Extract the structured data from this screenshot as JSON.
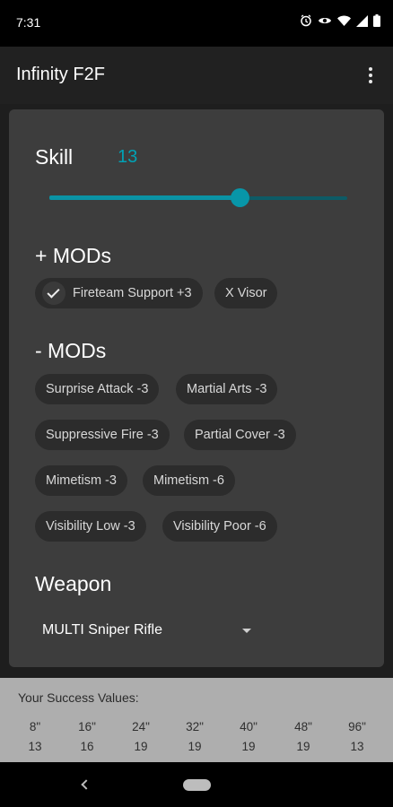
{
  "status_bar": {
    "time": "7:31",
    "icons": [
      "alarm-icon",
      "eye-icon",
      "wifi-icon",
      "signal-icon",
      "battery-icon"
    ]
  },
  "app_bar": {
    "title": "Infinity F2F",
    "overflow_icon": "more-vert-icon"
  },
  "skill": {
    "label": "Skill",
    "value": "13",
    "slider_fraction": 0.64,
    "accent": "#00a2b5"
  },
  "plus_mods": {
    "title": "+ MODs",
    "chips": [
      {
        "label": "Fireteam Support +3",
        "selected": true
      },
      {
        "label": "X Visor",
        "selected": false
      }
    ]
  },
  "minus_mods": {
    "title": "- MODs",
    "chips": [
      {
        "label": "Surprise Attack -3"
      },
      {
        "label": "Martial Arts -3"
      },
      {
        "label": "Suppressive Fire -3"
      },
      {
        "label": "Partial Cover -3"
      },
      {
        "label": "Mimetism -3"
      },
      {
        "label": "Mimetism -6"
      },
      {
        "label": "Visibility Low -3"
      },
      {
        "label": "Visibility Poor -6"
      }
    ]
  },
  "weapon": {
    "title": "Weapon",
    "selected": "MULTI Sniper Rifle"
  },
  "results": {
    "title": "Your Success Values:",
    "columns": [
      {
        "range": "8\"",
        "value": "13"
      },
      {
        "range": "16\"",
        "value": "16"
      },
      {
        "range": "24\"",
        "value": "19"
      },
      {
        "range": "32\"",
        "value": "19"
      },
      {
        "range": "40\"",
        "value": "19"
      },
      {
        "range": "48\"",
        "value": "19"
      },
      {
        "range": "96\"",
        "value": "13"
      }
    ]
  },
  "nav_bar": {
    "back_icon": "back-icon",
    "home_icon": "home-pill-icon"
  }
}
